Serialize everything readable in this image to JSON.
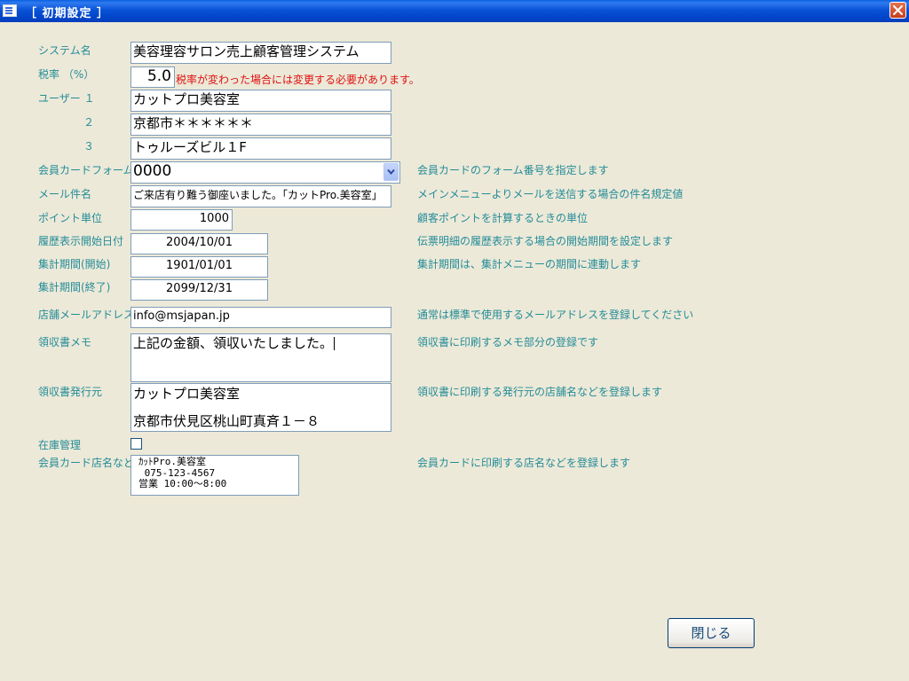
{
  "window": {
    "title": "［ 初期設定 ］"
  },
  "labels": {
    "system_name": "システム名",
    "tax_rate": "税率 （%）",
    "user1": "ユーザー １",
    "user2": "２",
    "user3": "３",
    "member_card_form": "会員カードフォーム",
    "mail_subject": "メール件名",
    "point_unit": "ポイント単位",
    "history_start_date": "履歴表示開始日付",
    "period_start": "集計期間(開始)",
    "period_end": "集計期間(終了)",
    "store_mail": "店舗メールアドレス",
    "receipt_memo": "領収書メモ",
    "receipt_issuer": "領収書発行元",
    "inventory": "在庫管理",
    "card_store_name": "会員カード店名など"
  },
  "fields": {
    "system_name": "美容理容サロン売上顧客管理システム",
    "tax_rate": "5.0",
    "user1": "カットプロ美容室",
    "user2": "京都市＊＊＊＊＊＊",
    "user3": "トゥルーズビル１F",
    "member_card_form": "0000",
    "mail_subject": "ご来店有り難う御座いました。「カットPro.美容室」",
    "point_unit": "1000",
    "history_start_date": "2004/10/01",
    "period_start": "1901/01/01",
    "period_end": "2099/12/31",
    "store_mail": "info@msjapan.jp",
    "receipt_memo": "上記の金額、領収いたしました。",
    "receipt_issuer_line1": "カットプロ美容室",
    "receipt_issuer_line2": "京都市伏見区桃山町真斉１－８",
    "inventory_checked": false,
    "card_store_lines": [
      "ｶｯﾄPro.美容室",
      " 075-123-4567",
      "営業 10:00～8:00"
    ]
  },
  "notes": {
    "tax_rate": "税率が変わった場合には変更する必要があります。",
    "member_card_form": "会員カードのフォーム番号を指定します",
    "mail_subject": "メインメニューよりメールを送信する場合の件名規定値",
    "point_unit": "顧客ポイントを計算するときの単位",
    "history_start_date": "伝票明細の履歴表示する場合の開始期間を設定します",
    "period_start": "集計期間は、集計メニューの期間に連動します",
    "store_mail": "通常は標準で使用するメールアドレスを登録してください",
    "receipt_memo": "領収書に印刷するメモ部分の登録です",
    "receipt_issuer": "領収書に印刷する発行元の店舗名などを登録します",
    "card_store_name": "会員カードに印刷する店名などを登録します"
  },
  "buttons": {
    "close": "閉じる"
  },
  "colors": {
    "label": "#248c98",
    "warning": "#e01010",
    "background": "#ece9d8",
    "titlebar": "#0a52d6"
  },
  "icons": {
    "window": "form-icon",
    "close": "close-icon",
    "dropdown": "chevron-down-icon"
  }
}
